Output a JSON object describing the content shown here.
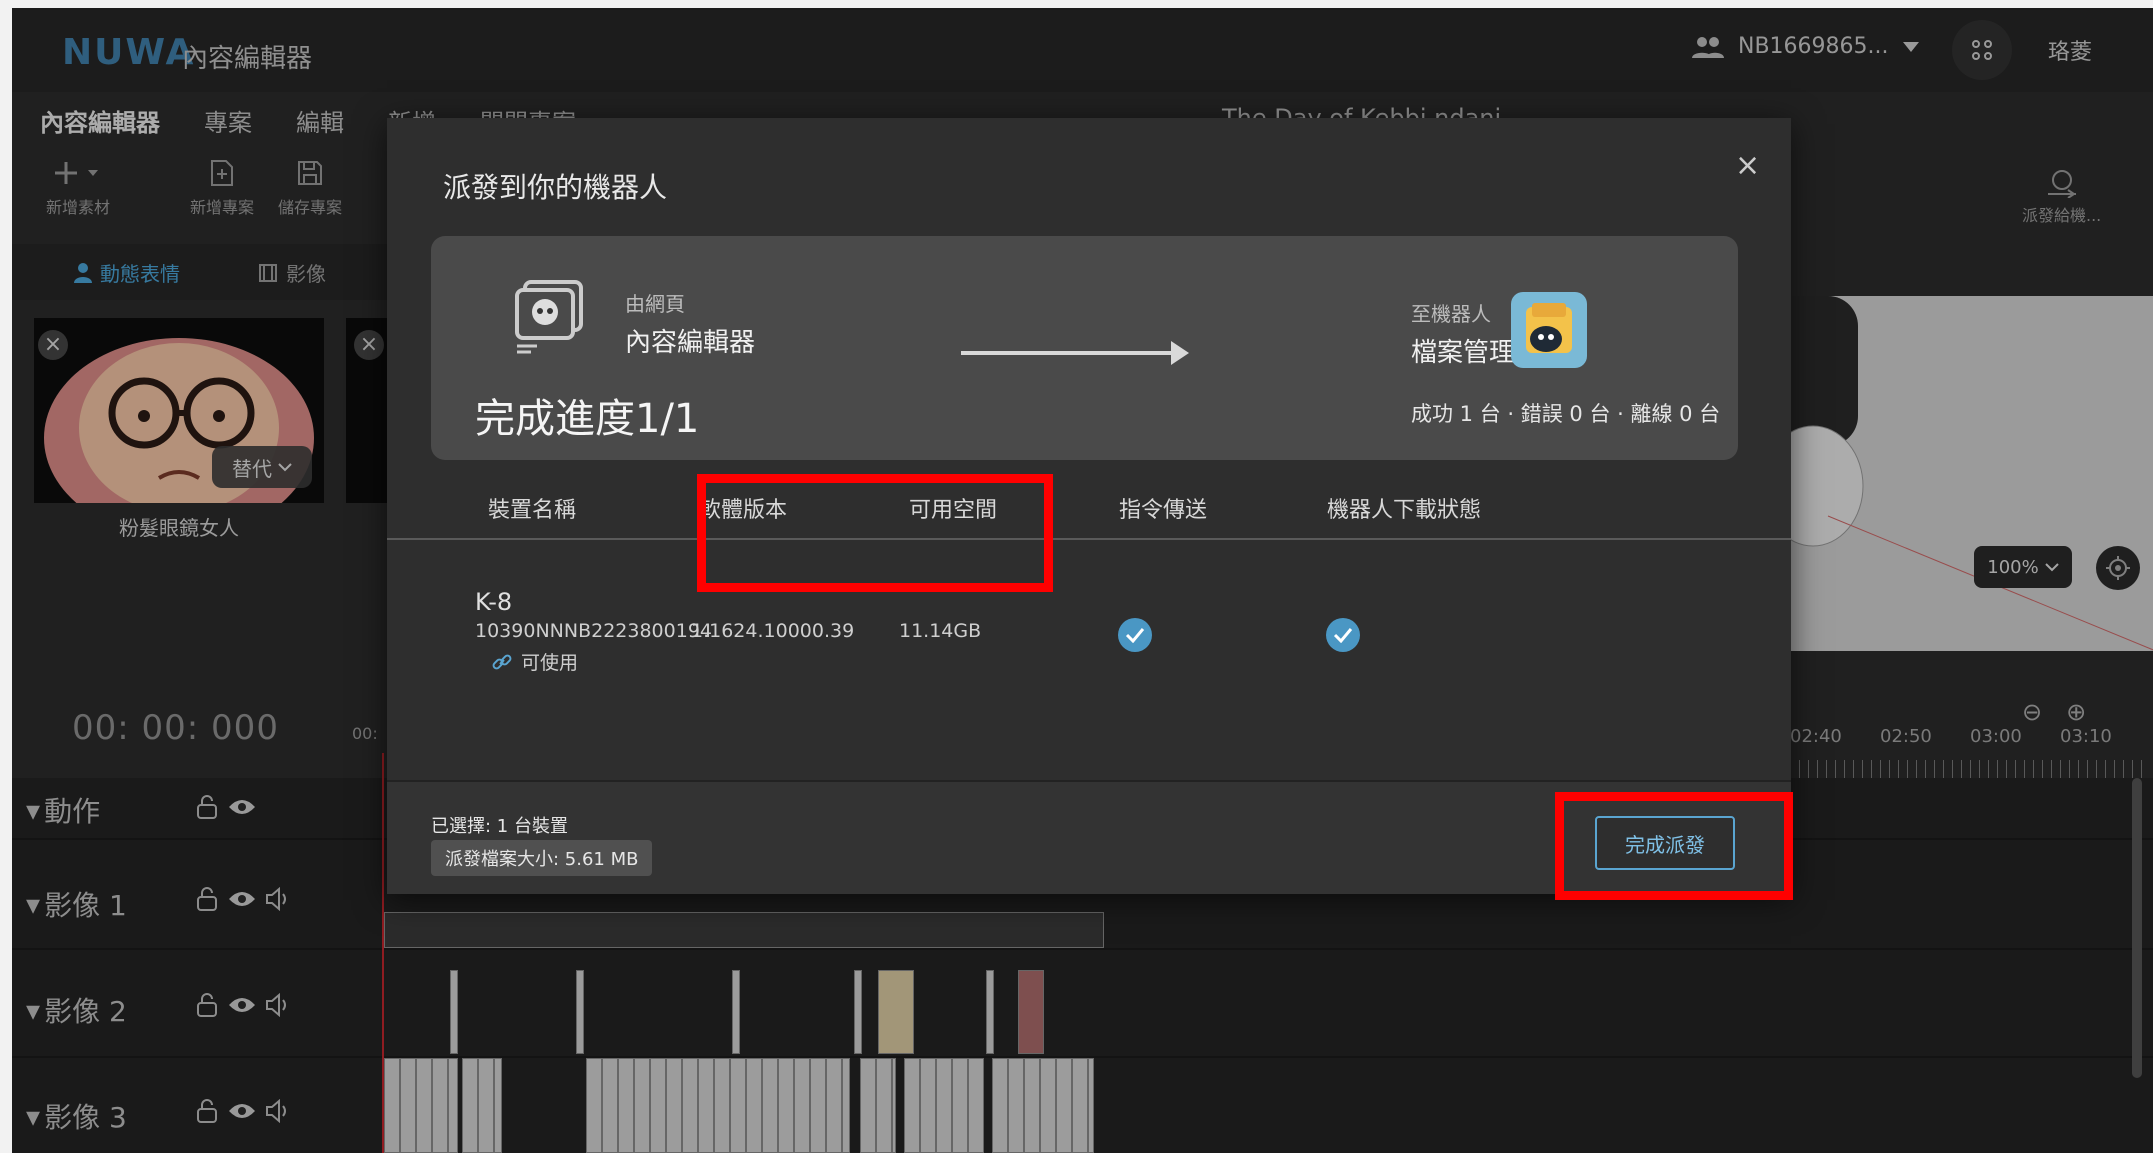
{
  "header": {
    "logo": "NUWA",
    "app_title": "內容編輯器",
    "account_id": "NB1669865...",
    "user_name": "珞菱"
  },
  "menubar": {
    "items": [
      "內容編輯器",
      "專案",
      "編輯",
      "新增",
      "關閉專案"
    ]
  },
  "doc_title": "The Day of Kebbi.ndani",
  "toolbar": {
    "add_asset": "新增素材",
    "new_project": "新增專案",
    "save_project": "儲存專案",
    "dispatch": "派發給機..."
  },
  "media_tabs": {
    "motion": "動態表情",
    "video": "影像"
  },
  "asset_card": {
    "replace": "替代",
    "label": "粉髮眼鏡女人"
  },
  "preview": {
    "zoom": "100%"
  },
  "timeline": {
    "timecode": "00: 00: 000",
    "ruler_start": "00:",
    "ticks": [
      "02:40",
      "02:50",
      "03:00",
      "03:10"
    ],
    "tracks": [
      "動作",
      "影像 1",
      "影像 2",
      "影像 3"
    ]
  },
  "modal": {
    "title": "派發到你的機器人",
    "from_label": "由網頁",
    "from_name": "內容編輯器",
    "to_label": "至機器人",
    "to_name": "檔案管理",
    "progress": "完成進度1/1",
    "stats": "成功 1 台 · 錯誤 0 台 · 離線 0 台",
    "columns": [
      "裝置名稱",
      "軟體版本",
      "可用空間",
      "指令傳送",
      "機器人下載狀態"
    ],
    "device": {
      "name": "K-8",
      "serial": "10390NNNB2223800194",
      "version": "1.1624.10000.39",
      "space": "11.14GB",
      "status": "可使用",
      "command_sent": true,
      "download_done": true
    },
    "footer": {
      "selected": "已選擇: 1 台裝置",
      "file_size": "派發檔案大小: 5.61 MB",
      "finish_button": "完成派發"
    }
  },
  "colors": {
    "accent": "#4a97c4",
    "highlight": "#ff0000",
    "background": "#2b2b2b"
  }
}
